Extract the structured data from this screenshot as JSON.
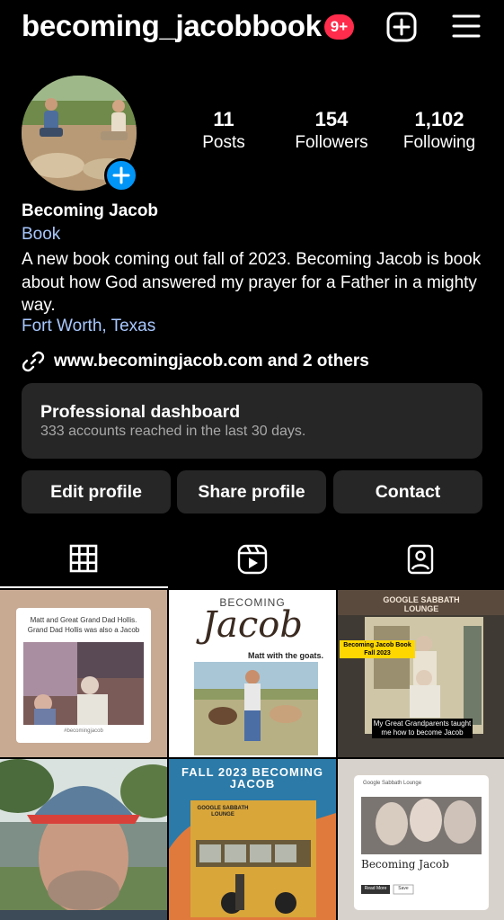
{
  "header": {
    "username": "becoming_jacobbook",
    "notification_badge": "9+",
    "add_icon": "plus-square-icon",
    "menu_icon": "hamburger-menu-icon"
  },
  "profile": {
    "stats": [
      {
        "value": "11",
        "label": "Posts"
      },
      {
        "value": "154",
        "label": "Followers"
      },
      {
        "value": "1,102",
        "label": "Following"
      }
    ],
    "name": "Becoming Jacob",
    "category": "Book",
    "bio": "A new book coming out fall of 2023. Becoming Jacob is book about how God answered my prayer for a Father in a mighty way.",
    "location": "Fort Worth, Texas",
    "link": "www.becomingjacob.com and 2 others"
  },
  "dashboard": {
    "title": "Professional dashboard",
    "subtitle": "333 accounts reached in the last 30 days."
  },
  "actions": {
    "edit": "Edit profile",
    "share": "Share profile",
    "contact": "Contact"
  },
  "tabs": {
    "grid_icon": "grid-icon",
    "reels_icon": "reels-icon",
    "tagged_icon": "tagged-icon",
    "active": "grid"
  },
  "posts": {
    "p1": {
      "caption": "Matt and Great Grand Dad Hollis. Grand Dad Hollis was also a Jacob",
      "tag": "#becomingjacob"
    },
    "p2": {
      "title_top": "BECOMING",
      "title_script": "Jacob",
      "caption": "Matt with the goats."
    },
    "p3": {
      "header": "GOOGLE SABBATH LOUNGE",
      "badge": "Becoming Jacob Book Fall 2023",
      "caption": "My Great Grandparents taught me how to become Jacob"
    },
    "p5": {
      "title": "FALL 2023 BECOMING JACOB",
      "sub": "GOOGLE SABBATH LOUNGE"
    },
    "p6": {
      "top": "Google Sabbath Lounge",
      "title": "Becoming Jacob",
      "btn1": "Read More",
      "btn2": "Save"
    }
  },
  "colors": {
    "accent_blue": "#0095f6",
    "badge_red": "#ff2c4b",
    "link_blue": "#a8c8ff",
    "card_bg": "#262626"
  }
}
